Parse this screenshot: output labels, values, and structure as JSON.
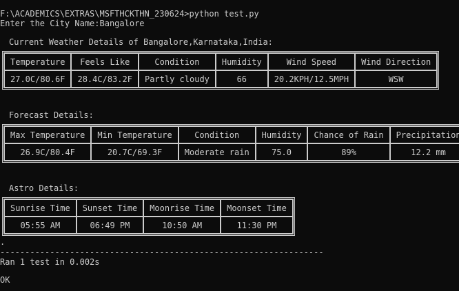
{
  "console": {
    "command_line": "F:\\ACADEMICS\\EXTRAS\\MSFTHCKTHN_230624>python test.py",
    "prompt_line": "Enter the City Name:Bangalore",
    "separator": "----------------------------------------------------------------------",
    "dot": ".",
    "ran_line": "Ran 1 test in 0.002s",
    "status_line": "OK"
  },
  "current_weather": {
    "title": "Current Weather Details of Bangalore,Karnataka,India:",
    "headers": [
      "Temperature",
      "Feels Like",
      "Condition",
      "Humidity",
      "Wind Speed",
      "Wind Direction"
    ],
    "values": [
      "27.0C/80.6F",
      "28.4C/83.2F",
      "Partly cloudy",
      "66",
      "20.2KPH/12.5MPH",
      "WSW"
    ]
  },
  "forecast": {
    "title": "Forecast Details:",
    "headers": [
      "Max Temperature",
      "Min Temperature",
      "Condition",
      "Humidity",
      "Chance of Rain",
      "Precipitation"
    ],
    "values": [
      "26.9C/80.4F",
      "20.7C/69.3F",
      "Moderate rain",
      "75.0",
      "89%",
      "12.2 mm"
    ]
  },
  "astro": {
    "title": "Astro Details:",
    "headers": [
      "Sunrise Time",
      "Sunset Time",
      "Moonrise Time",
      "Moonset Time"
    ],
    "values": [
      "05:55 AM",
      "06:49 PM",
      "10:50 AM",
      "11:30 PM"
    ]
  }
}
